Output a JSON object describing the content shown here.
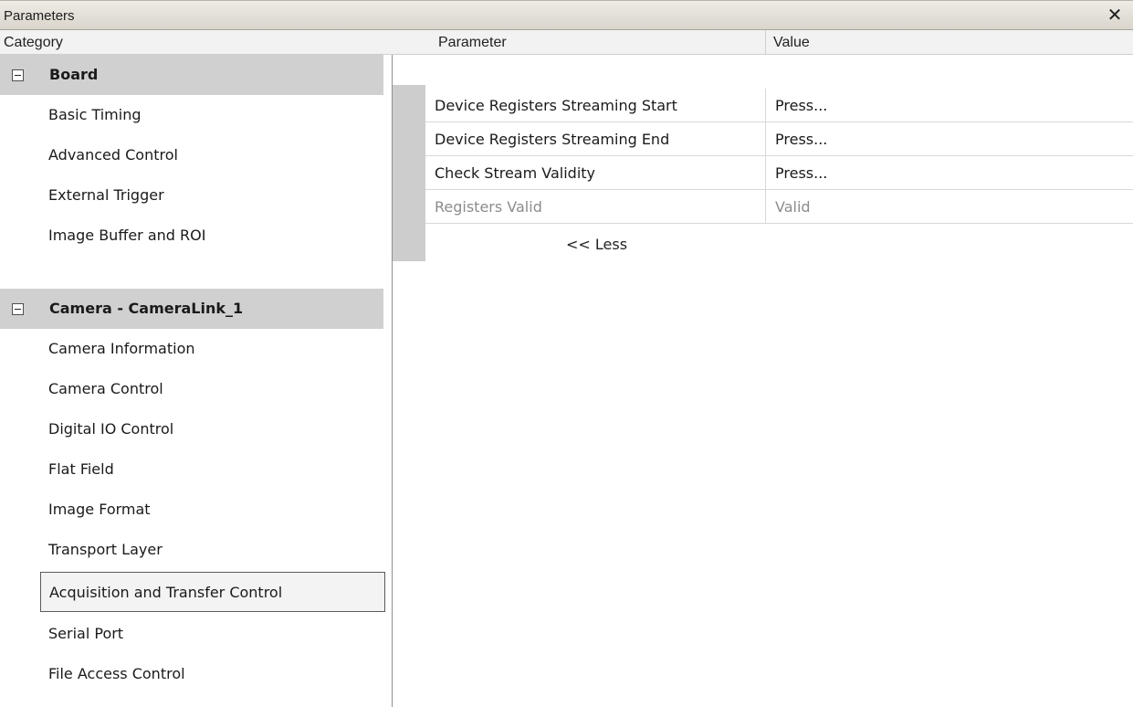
{
  "window": {
    "title": "Parameters",
    "close_glyph": "✕"
  },
  "headers": {
    "category": "Category",
    "parameter": "Parameter",
    "value": "Value"
  },
  "categories": [
    {
      "label": "Board",
      "type": "group"
    },
    {
      "label": "Basic Timing",
      "type": "item"
    },
    {
      "label": "Advanced Control",
      "type": "item"
    },
    {
      "label": "External Trigger",
      "type": "item"
    },
    {
      "label": "Image Buffer and ROI",
      "type": "item"
    },
    {
      "label": "Camera - CameraLink_1",
      "type": "group"
    },
    {
      "label": "Camera Information",
      "type": "item"
    },
    {
      "label": "Camera Control",
      "type": "item"
    },
    {
      "label": "Digital IO Control",
      "type": "item"
    },
    {
      "label": "Flat Field",
      "type": "item"
    },
    {
      "label": "Image Format",
      "type": "item"
    },
    {
      "label": "Transport Layer",
      "type": "item"
    },
    {
      "label": "Acquisition and Transfer Control",
      "type": "item",
      "selected": true
    },
    {
      "label": "Serial Port",
      "type": "item"
    },
    {
      "label": "File Access Control",
      "type": "item"
    }
  ],
  "parameters": [
    {
      "name": "Device Registers Streaming Start",
      "value": "Press...",
      "readonly": false
    },
    {
      "name": "Device Registers Streaming End",
      "value": "Press...",
      "readonly": false
    },
    {
      "name": "Check Stream Validity",
      "value": "Press...",
      "readonly": false
    },
    {
      "name": "Registers Valid",
      "value": "Valid",
      "readonly": true
    }
  ],
  "less_link": "<< Less"
}
